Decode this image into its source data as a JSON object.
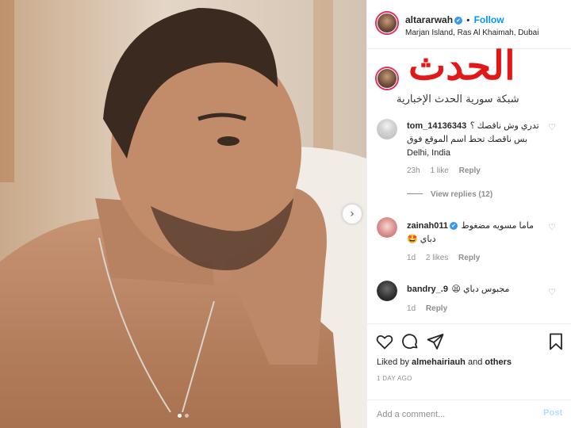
{
  "post": {
    "author": "altararwah",
    "follow_label": "Follow",
    "separator": "•",
    "verified_mark": "✔",
    "location": "Marjan Island, Ras Al Khaimah, Dubai"
  },
  "watermark": {
    "logo": "الحدث",
    "text": "شبكة سورية الحدث الإخبارية"
  },
  "comments": [
    {
      "user": "tom_14136343",
      "lines": [
        "تدري وش ناقصك ؟",
        "بس ناقصك تحط اسم الموقع فوق",
        "Delhi, India"
      ],
      "time": "23h",
      "likes": "1 like",
      "reply": "Reply",
      "view_replies": "View replies (12)"
    },
    {
      "user": "zainah011",
      "verified": true,
      "lines": [
        "ماما مسويه مضغوط",
        "دباي 🤩"
      ],
      "time": "1d",
      "likes": "2 likes",
      "reply": "Reply"
    },
    {
      "user": "bandry_.9",
      "lines": [
        "مجبوس دباي 😫"
      ],
      "time": "1d",
      "reply": "Reply"
    }
  ],
  "actions": {
    "liked_by_prefix": "Liked by",
    "liked_by_user": "almehairiauh",
    "liked_by_and": "and",
    "liked_by_others": "others",
    "time_ago": "1 DAY AGO"
  },
  "composer": {
    "placeholder": "Add a comment...",
    "post_label": "Post"
  },
  "icons": {
    "heart": "♡",
    "next": "›"
  },
  "colors": {
    "link_blue": "#0095f6",
    "post_disabled": "#b2dffc",
    "watermark_red": "#e01818",
    "story_ring": "#e1306c"
  },
  "carousel": {
    "total": 2,
    "current": 1
  }
}
